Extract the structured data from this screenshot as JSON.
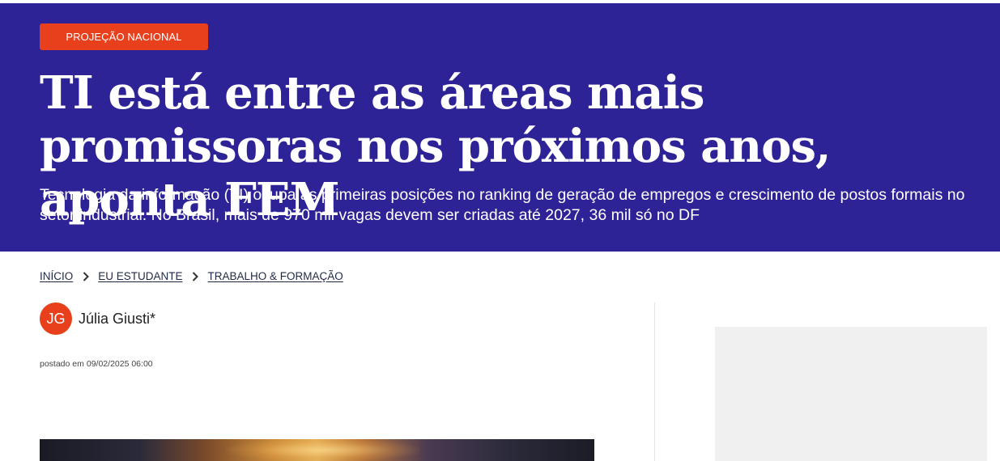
{
  "header": {
    "tag": "PROJEÇÃO NACIONAL",
    "title": "TI está entre as áreas mais promissoras nos próximos anos, aponta FEM",
    "subtitle": "Tecnologia da informação (TI) ocupa as primeiras posições no ranking de geração de empregos e crescimento de postos formais no setor industrial. No Brasil, mais de 970 mil vagas devem ser criadas até 2027, 36 mil só no DF"
  },
  "breadcrumb": {
    "items": [
      {
        "label": "INÍCIO"
      },
      {
        "label": "EU ESTUDANTE"
      },
      {
        "label": "TRABALHO & FORMAÇÃO"
      }
    ],
    "separator_icon": "chevron-right-icon"
  },
  "author": {
    "initials": "JG",
    "name": "Júlia Giusti*"
  },
  "posted": {
    "label": "postado em",
    "date": "09/02/2025 06:00"
  },
  "colors": {
    "hero_background": "#2e2396",
    "accent": "#e8401c",
    "ad_placeholder": "#f0f0f0"
  }
}
